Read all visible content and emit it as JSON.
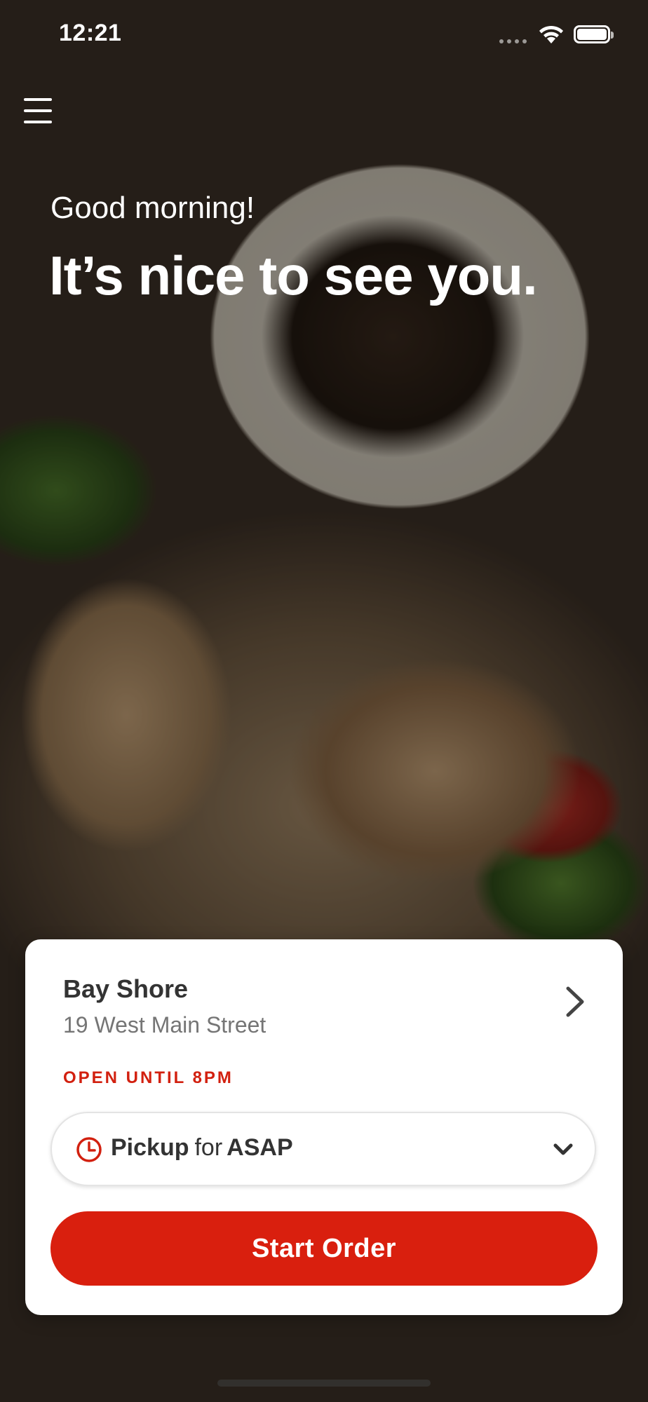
{
  "status_bar": {
    "time": "12:21",
    "wifi_icon": "wifi-icon",
    "battery_icon": "battery-icon"
  },
  "header": {
    "menu_icon": "hamburger-menu-icon",
    "greeting": "Good morning!",
    "headline": "It’s nice to see you."
  },
  "location": {
    "name": "Bay Shore",
    "address": "19 West Main Street",
    "open_status": "OPEN UNTIL 8PM",
    "chevron_icon": "chevron-right-icon"
  },
  "order_mode": {
    "icon": "clock-icon",
    "mode": "Pickup",
    "connector": "for",
    "time": "ASAP",
    "dropdown_icon": "chevron-down-icon"
  },
  "cta": {
    "label": "Start Order"
  },
  "colors": {
    "accent": "#d91f0e",
    "open_status": "#d2200f",
    "card_bg": "#ffffff",
    "text_primary": "#333333",
    "text_secondary": "#757575"
  }
}
